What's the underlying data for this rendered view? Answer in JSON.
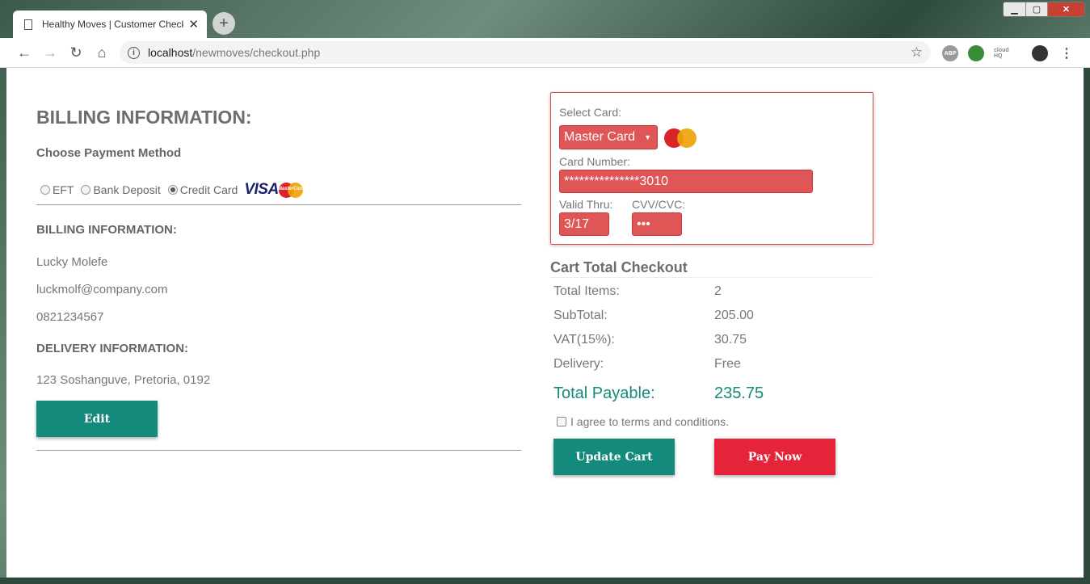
{
  "browser": {
    "tab_title": "Healthy Moves | Customer Check",
    "url_host": "localhost",
    "url_path": "/newmoves/checkout.php",
    "new_tab": "+",
    "ext_abp": "ABP",
    "ext_cloud": "cloud HQ"
  },
  "billing": {
    "heading": "BILLING INFORMATION:",
    "choose_label": "Choose Payment Method",
    "methods": [
      "EFT",
      "Bank Deposit",
      "Credit Card"
    ],
    "selected_method": "Credit Card",
    "visa_logo": "VISA",
    "mc_logo": "MasterCard",
    "info_heading": "BILLING INFORMATION:",
    "name": "Lucky Molefe",
    "email": "luckmolf@company.com",
    "phone": "0821234567",
    "delivery_heading": "DELIVERY INFORMATION:",
    "address": "123 Soshanguve, Pretoria, 0192",
    "edit_button": "Edit"
  },
  "card": {
    "select_label": "Select Card:",
    "selected_card": "Master Card",
    "number_label": "Card Number:",
    "number_value": "***************3010",
    "valid_label": "Valid Thru:",
    "valid_value": "3/17",
    "cvv_label": "CVV/CVC:",
    "cvv_value": "•••"
  },
  "cart": {
    "title": "Cart Total Checkout",
    "rows": [
      {
        "label": "Total Items:",
        "value": "2"
      },
      {
        "label": "SubTotal:",
        "value": "205.00"
      },
      {
        "label": "VAT(15%):",
        "value": "30.75"
      },
      {
        "label": "Delivery:",
        "value": "Free"
      }
    ],
    "total_label": "Total Payable:",
    "total_value": "235.75",
    "agree_text": "I agree to terms and conditions.",
    "update_button": "Update Cart",
    "pay_button": "Pay Now"
  }
}
